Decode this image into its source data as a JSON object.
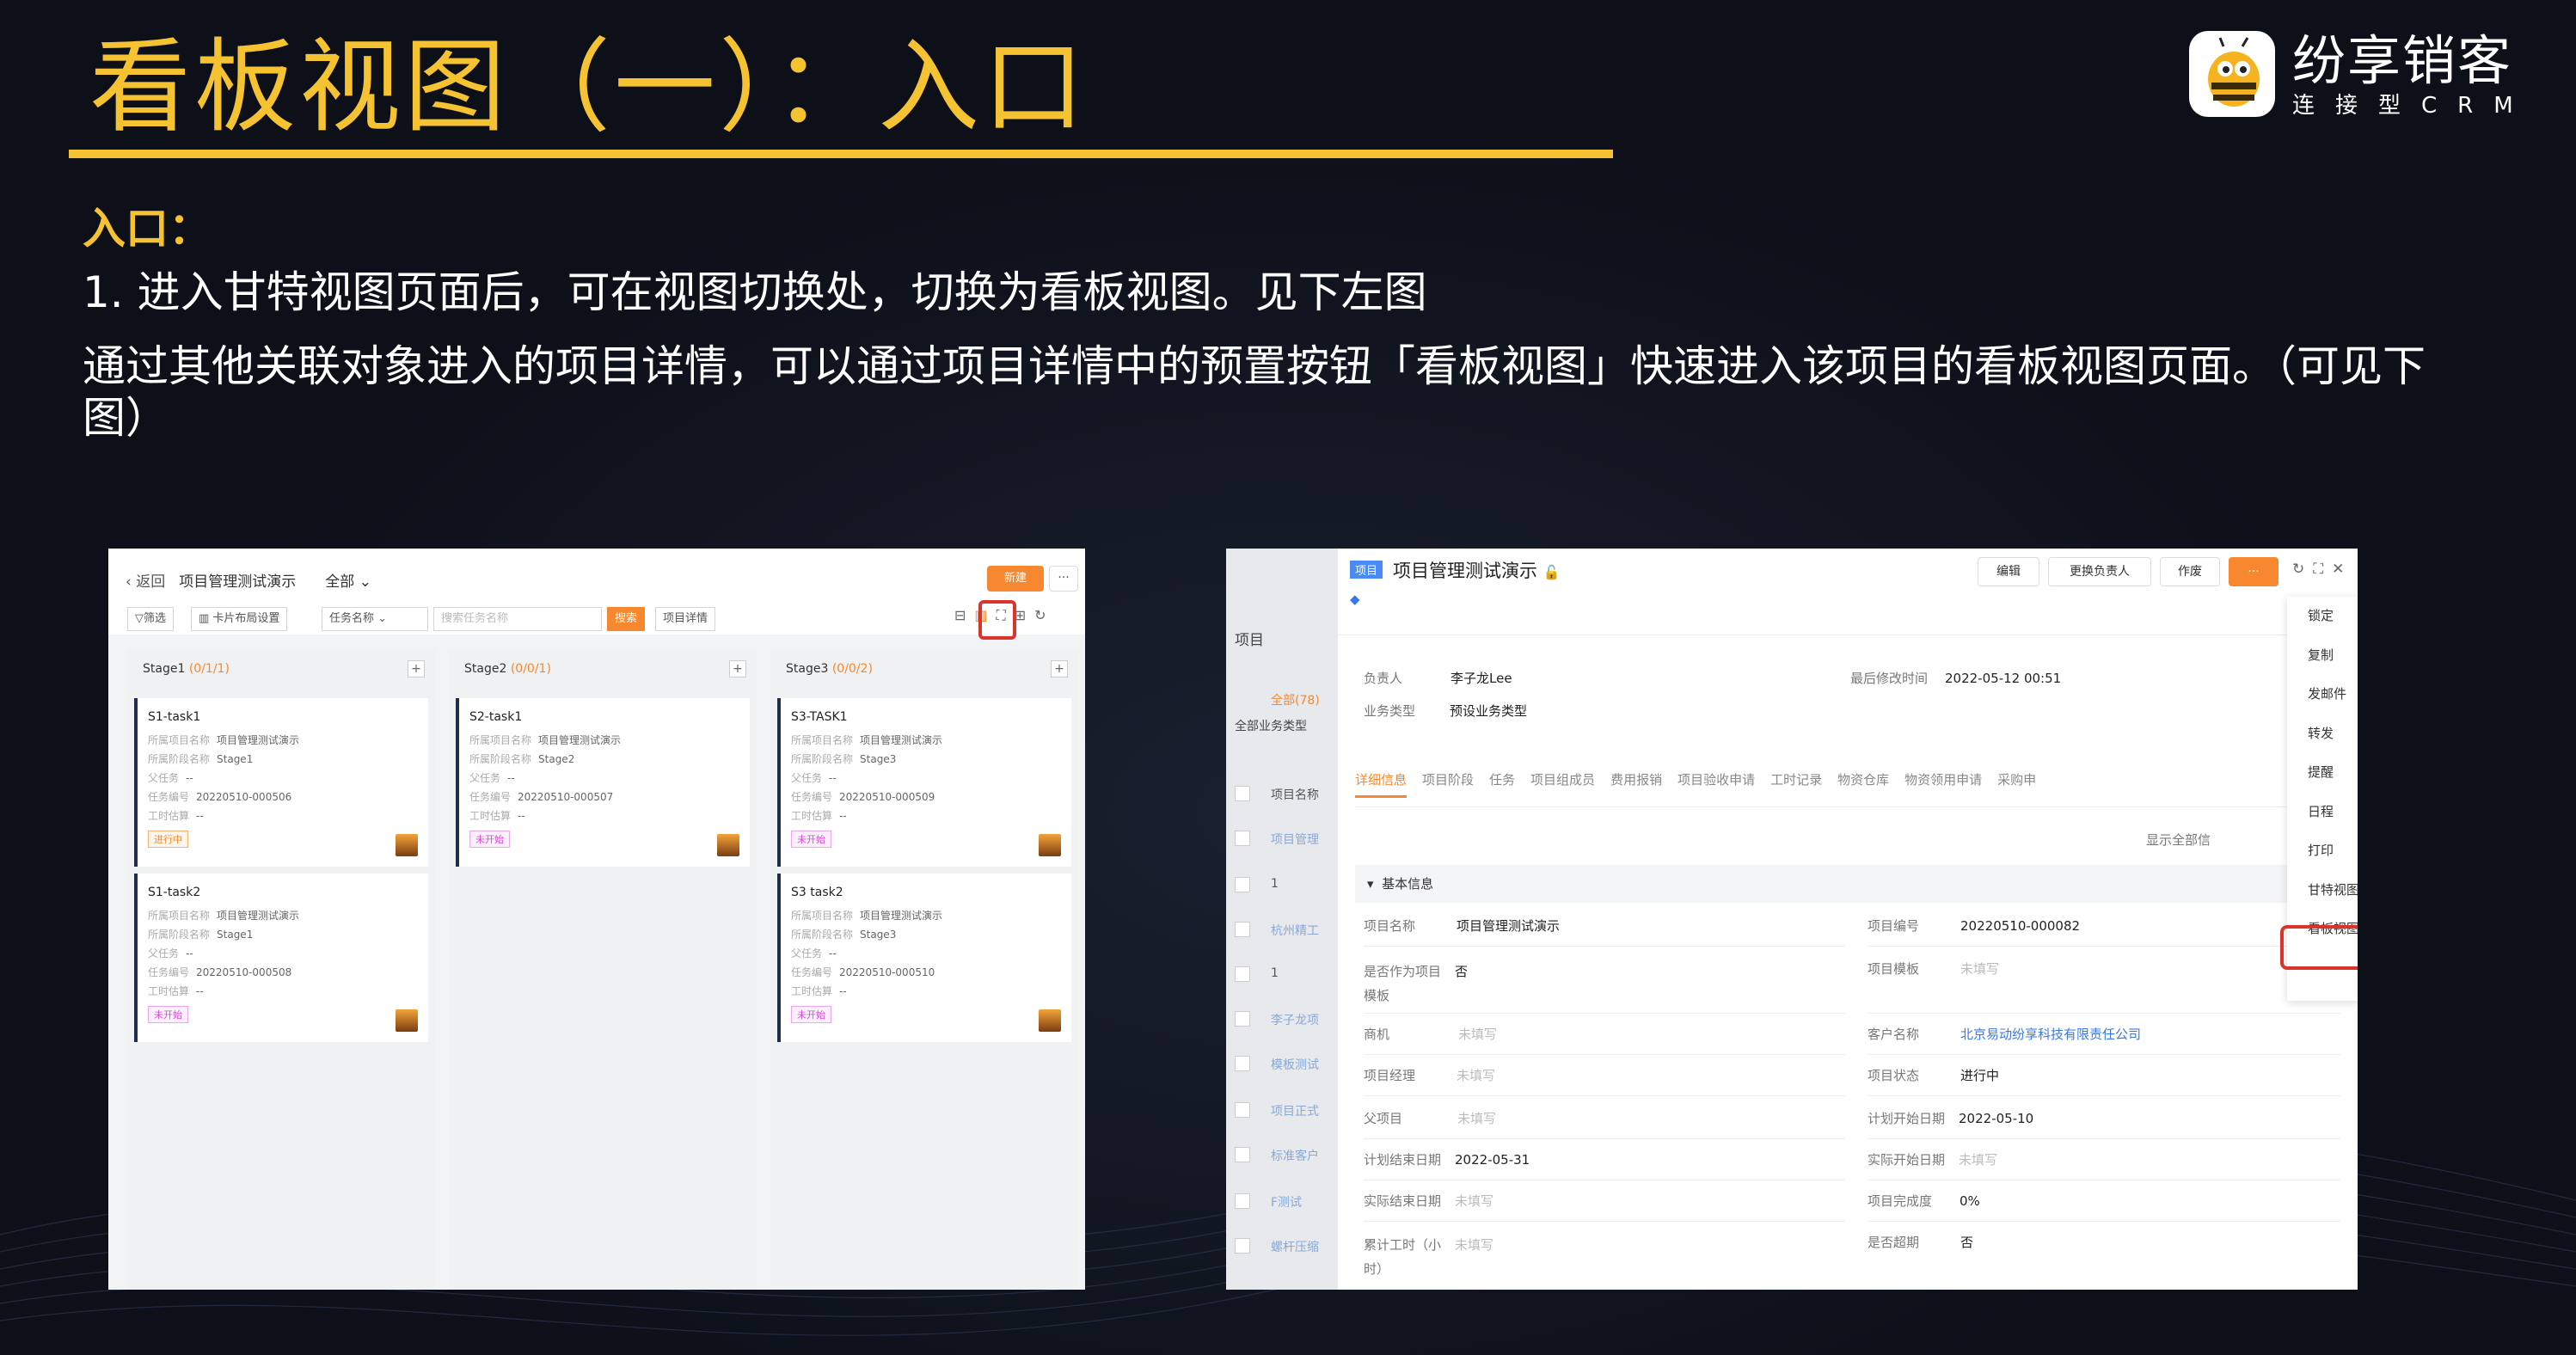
{
  "slide": {
    "title": "看板视图（一）：入口",
    "logo_name": "纷享销客",
    "logo_sub": "连接型CRM",
    "entry_heading": "入口：",
    "point1": "1.   进入甘特视图页面后，可在视图切换处，切换为看板视图。见下左图",
    "point2": "通过其他关联对象进入的项目详情，可以通过项目详情中的预置按钮「看板视图」快速进入该项目的看板视图页面。（可见下图）",
    "colors": {
      "accent": "#f5c332",
      "brand_orange": "#f7882f",
      "highlight": "#d9352c"
    }
  },
  "left": {
    "back": "返回",
    "project": "项目管理测试演示",
    "scope": "全部",
    "new_btn": "新建",
    "more_btn": "···",
    "toolbar": {
      "filter": "筛选",
      "card_layout": "卡片布局设置",
      "task_name": "任务名称",
      "search_placeholder": "搜索任务名称",
      "search_btn": "搜索",
      "project_detail": "项目详情"
    },
    "columns": [
      {
        "name": "Stage1",
        "count": "(0/1/1)",
        "cards": [
          {
            "title": "S1-task1",
            "stage": "Stage1",
            "code": "20220510-000506",
            "status": "进行中"
          },
          {
            "title": "S1-task2",
            "stage": "Stage1",
            "code": "20220510-000508",
            "status": "未开始"
          }
        ]
      },
      {
        "name": "Stage2",
        "count": "(0/0/1)",
        "cards": [
          {
            "title": "S2-task1",
            "stage": "Stage2",
            "code": "20220510-000507",
            "status": "未开始"
          }
        ]
      },
      {
        "name": "Stage3",
        "count": "(0/0/2)",
        "cards": [
          {
            "title": "S3-TASK1",
            "stage": "Stage3",
            "code": "20220510-000509",
            "status": "未开始"
          },
          {
            "title": "S3 task2",
            "stage": "Stage3",
            "code": "20220510-000510",
            "status": "未开始"
          }
        ]
      }
    ],
    "card_labels": {
      "project": "所属项目名称",
      "project_val": "项目管理测试演示",
      "stage": "所属阶段名称",
      "parent": "父任务",
      "parent_val": "--",
      "code": "任务编号",
      "hours": "工时估算",
      "hours_val": "--"
    }
  },
  "right": {
    "side": {
      "title": "项目",
      "filter_all": "全部(78)",
      "biz_type": "全部业务类型",
      "col_name": "项目名称",
      "rows": [
        "项目管理",
        "1",
        "杭州精工",
        "1",
        "李子龙项",
        "模板测试",
        "项目正式",
        "标准客户",
        "F测试",
        "螺杆压缩"
      ]
    },
    "badge": "项目",
    "title": "项目管理测试演示",
    "buttons": {
      "edit": "编辑",
      "change_owner": "更换负责人",
      "void": "作废",
      "more": "···"
    },
    "owner_k": "负责人",
    "owner_v": "李子龙Lee",
    "biz_k": "业务类型",
    "biz_v": "预设业务类型",
    "modified_k": "最后修改时间",
    "modified_v": "2022-05-12 00:51",
    "tabs": [
      "详细信息",
      "项目阶段",
      "任务",
      "项目组成员",
      "费用报销",
      "项目验收申请",
      "工时记录",
      "物资仓库",
      "物资领用申请",
      "采购申"
    ],
    "show_all": "显示全部信",
    "section": "基本信息",
    "fields": [
      {
        "k": "项目名称",
        "v": "项目管理测试演示",
        "k2": "项目编号",
        "v2": "20220510-000082"
      },
      {
        "k": "是否作为项目",
        "k_b": "模板",
        "v": "否",
        "k2": "项目模板",
        "v2": "未填写"
      },
      {
        "k": "商机",
        "v": "未填写",
        "k2": "客户名称",
        "v2": "北京易动纷享科技有限责任公司"
      },
      {
        "k": "项目经理",
        "v": "未填写",
        "k2": "项目状态",
        "v2": "进行中"
      },
      {
        "k": "父项目",
        "v": "未填写",
        "k2": "计划开始日期",
        "v2": "2022-05-10"
      },
      {
        "k": "计划结束日期",
        "v": "2022-05-31",
        "k2": "实际开始日期",
        "v2": "未填写"
      },
      {
        "k": "实际结束日期",
        "v": "未填写",
        "k2": "项目完成度",
        "v2": "0%"
      },
      {
        "k": "累计工时（小",
        "k_b": "时）",
        "v": "未填写",
        "k2": "是否超期",
        "v2": "否"
      }
    ],
    "menu": [
      "锁定",
      "复制",
      "发邮件",
      "转发",
      "提醒",
      "日程",
      "打印",
      "甘特视图",
      "看板视图"
    ]
  }
}
